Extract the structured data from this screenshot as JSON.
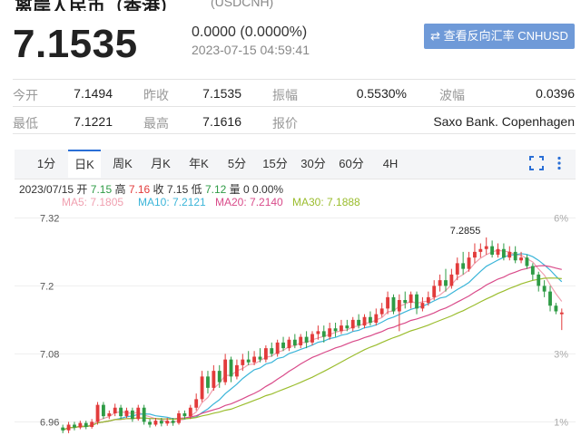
{
  "header": {
    "title": "离岸人民币（香港）",
    "code": "(USDCNH)",
    "price": "7.1535",
    "change": "0.0000 (0.0000%)",
    "timestamp": "2023-07-15 04:59:41",
    "reverse_button": "⇄ 查看反向汇率 CNHUSD"
  },
  "stats": {
    "row1": [
      {
        "label": "今开",
        "value": "7.1494"
      },
      {
        "label": "昨收",
        "value": "7.1535"
      },
      {
        "label": "振幅",
        "value": "0.5530%"
      },
      {
        "label": "波幅",
        "value": "0.0396"
      }
    ],
    "row2": [
      {
        "label": "最低",
        "value": "7.1221"
      },
      {
        "label": "最高",
        "value": "7.1616"
      },
      {
        "label": "报价",
        "value": "Saxo Bank. Copenhagen"
      }
    ]
  },
  "tabs": [
    "1分",
    "日K",
    "周K",
    "月K",
    "年K",
    "5分",
    "15分",
    "30分",
    "60分",
    "4H"
  ],
  "active_tab": "日K",
  "controls": {
    "fullscreen_icon": "fullscreen-icon",
    "more_icon": "more-vertical-icon"
  },
  "ohlc": {
    "date": "2023/07/15",
    "open_label": "开",
    "open": "7.15",
    "high_label": "高",
    "high": "7.16",
    "close_label": "收",
    "close": "7.15",
    "low_label": "低",
    "low": "7.12",
    "vol_label": "量",
    "vol": "0",
    "pct": "0.00%"
  },
  "ma_legend": [
    {
      "text": "MA5: 7.1805",
      "color": "#f0a0b0"
    },
    {
      "text": "MA10: 7.2121",
      "color": "#3bb5d9"
    },
    {
      "text": "MA20: 7.2140",
      "color": "#d94b8a"
    },
    {
      "text": "MA30: 7.1888",
      "color": "#9bbd2e"
    }
  ],
  "colors": {
    "up": "#e23b3b",
    "down": "#2e9b45",
    "accent": "#2a6fd6"
  },
  "chart_data": {
    "type": "candlestick",
    "y_ticks": [
      "7.32",
      "7.2",
      "7.08",
      "6.96"
    ],
    "y_tick_values": [
      7.32,
      7.2,
      7.08,
      6.96
    ],
    "right_ticks": [
      "6%",
      "3%",
      "1%"
    ],
    "right_tick_values": [
      7.32,
      7.08,
      6.96
    ],
    "ylim": [
      6.935,
      7.335
    ],
    "max_label": "7.2855",
    "max_index": 73,
    "candles": [
      [
        6.95,
        6.945,
        6.955,
        6.94
      ],
      [
        6.945,
        6.955,
        6.96,
        6.94
      ],
      [
        6.955,
        6.95,
        6.96,
        6.945
      ],
      [
        6.95,
        6.958,
        6.962,
        6.947
      ],
      [
        6.958,
        6.951,
        6.962,
        6.947
      ],
      [
        6.951,
        6.96,
        6.965,
        6.948
      ],
      [
        6.96,
        6.99,
        6.995,
        6.955
      ],
      [
        6.99,
        6.97,
        6.995,
        6.965
      ],
      [
        6.97,
        6.975,
        6.98,
        6.965
      ],
      [
        6.975,
        6.985,
        6.992,
        6.97
      ],
      [
        6.985,
        6.97,
        6.99,
        6.965
      ],
      [
        6.97,
        6.98,
        6.985,
        6.967
      ],
      [
        6.98,
        6.965,
        6.985,
        6.96
      ],
      [
        6.965,
        6.985,
        6.99,
        6.962
      ],
      [
        6.985,
        6.96,
        6.99,
        6.955
      ],
      [
        6.96,
        6.955,
        6.965,
        6.95
      ],
      [
        6.955,
        6.962,
        6.967,
        6.952
      ],
      [
        6.962,
        6.957,
        6.967,
        6.952
      ],
      [
        6.957,
        6.962,
        6.967,
        6.953
      ],
      [
        6.962,
        6.958,
        6.967,
        6.953
      ],
      [
        6.958,
        6.975,
        6.98,
        6.955
      ],
      [
        6.975,
        6.97,
        6.98,
        6.965
      ],
      [
        6.97,
        6.985,
        6.99,
        6.965
      ],
      [
        6.985,
        7.0,
        7.01,
        6.98
      ],
      [
        7.0,
        7.04,
        7.05,
        6.995
      ],
      [
        7.04,
        7.02,
        7.05,
        7.01
      ],
      [
        7.02,
        7.05,
        7.06,
        7.015
      ],
      [
        7.05,
        7.03,
        7.06,
        7.02
      ],
      [
        7.03,
        7.07,
        7.08,
        7.025
      ],
      [
        7.07,
        7.04,
        7.075,
        7.03
      ],
      [
        7.04,
        7.06,
        7.07,
        7.035
      ],
      [
        7.06,
        7.07,
        7.08,
        7.05
      ],
      [
        7.07,
        7.065,
        7.085,
        7.06
      ],
      [
        7.065,
        7.075,
        7.085,
        7.06
      ],
      [
        7.075,
        7.07,
        7.09,
        7.065
      ],
      [
        7.07,
        7.09,
        7.095,
        7.065
      ],
      [
        7.09,
        7.08,
        7.1,
        7.075
      ],
      [
        7.08,
        7.1,
        7.105,
        7.075
      ],
      [
        7.1,
        7.09,
        7.11,
        7.085
      ],
      [
        7.09,
        7.105,
        7.11,
        7.085
      ],
      [
        7.105,
        7.095,
        7.115,
        7.09
      ],
      [
        7.095,
        7.11,
        7.115,
        7.09
      ],
      [
        7.11,
        7.1,
        7.12,
        7.09
      ],
      [
        7.1,
        7.115,
        7.12,
        7.095
      ],
      [
        7.115,
        7.12,
        7.13,
        7.105
      ],
      [
        7.12,
        7.11,
        7.13,
        7.1
      ],
      [
        7.11,
        7.125,
        7.135,
        7.105
      ],
      [
        7.125,
        7.12,
        7.135,
        7.11
      ],
      [
        7.12,
        7.13,
        7.14,
        7.115
      ],
      [
        7.13,
        7.125,
        7.14,
        7.12
      ],
      [
        7.125,
        7.14,
        7.145,
        7.12
      ],
      [
        7.14,
        7.13,
        7.15,
        7.125
      ],
      [
        7.13,
        7.145,
        7.15,
        7.125
      ],
      [
        7.145,
        7.135,
        7.155,
        7.13
      ],
      [
        7.135,
        7.15,
        7.16,
        7.13
      ],
      [
        7.15,
        7.16,
        7.17,
        7.145
      ],
      [
        7.16,
        7.18,
        7.19,
        7.15
      ],
      [
        7.18,
        7.155,
        7.185,
        7.15
      ],
      [
        7.155,
        7.175,
        7.185,
        7.12
      ],
      [
        7.175,
        7.17,
        7.19,
        7.16
      ],
      [
        7.17,
        7.185,
        7.19,
        7.16
      ],
      [
        7.185,
        7.16,
        7.19,
        7.15
      ],
      [
        7.16,
        7.17,
        7.18,
        7.155
      ],
      [
        7.17,
        7.18,
        7.19,
        7.165
      ],
      [
        7.18,
        7.2,
        7.21,
        7.175
      ],
      [
        7.2,
        7.21,
        7.22,
        7.19
      ],
      [
        7.21,
        7.2,
        7.23,
        7.19
      ],
      [
        7.2,
        7.22,
        7.23,
        7.195
      ],
      [
        7.22,
        7.24,
        7.25,
        7.21
      ],
      [
        7.24,
        7.23,
        7.26,
        7.22
      ],
      [
        7.23,
        7.25,
        7.26,
        7.225
      ],
      [
        7.25,
        7.26,
        7.275,
        7.24
      ],
      [
        7.26,
        7.265,
        7.275,
        7.25
      ],
      [
        7.265,
        7.27,
        7.2855,
        7.255
      ],
      [
        7.27,
        7.255,
        7.28,
        7.25
      ],
      [
        7.255,
        7.265,
        7.275,
        7.25
      ],
      [
        7.265,
        7.25,
        7.275,
        7.245
      ],
      [
        7.25,
        7.26,
        7.27,
        7.245
      ],
      [
        7.26,
        7.245,
        7.27,
        7.24
      ],
      [
        7.245,
        7.25,
        7.26,
        7.24
      ],
      [
        7.25,
        7.235,
        7.255,
        7.23
      ],
      [
        7.235,
        7.22,
        7.24,
        7.21
      ],
      [
        7.22,
        7.2,
        7.225,
        7.19
      ],
      [
        7.2,
        7.19,
        7.21,
        7.18
      ],
      [
        7.19,
        7.165,
        7.2,
        7.155
      ],
      [
        7.165,
        7.155,
        7.17,
        7.15
      ],
      [
        7.15,
        7.153,
        7.16,
        7.122
      ]
    ],
    "ma": [
      {
        "name": "MA5",
        "color": "#f0a0b0"
      },
      {
        "name": "MA10",
        "color": "#3bb5d9"
      },
      {
        "name": "MA20",
        "color": "#d94b8a"
      },
      {
        "name": "MA30",
        "color": "#9bbd2e"
      }
    ],
    "ma_windows": [
      5,
      10,
      20,
      30
    ]
  }
}
